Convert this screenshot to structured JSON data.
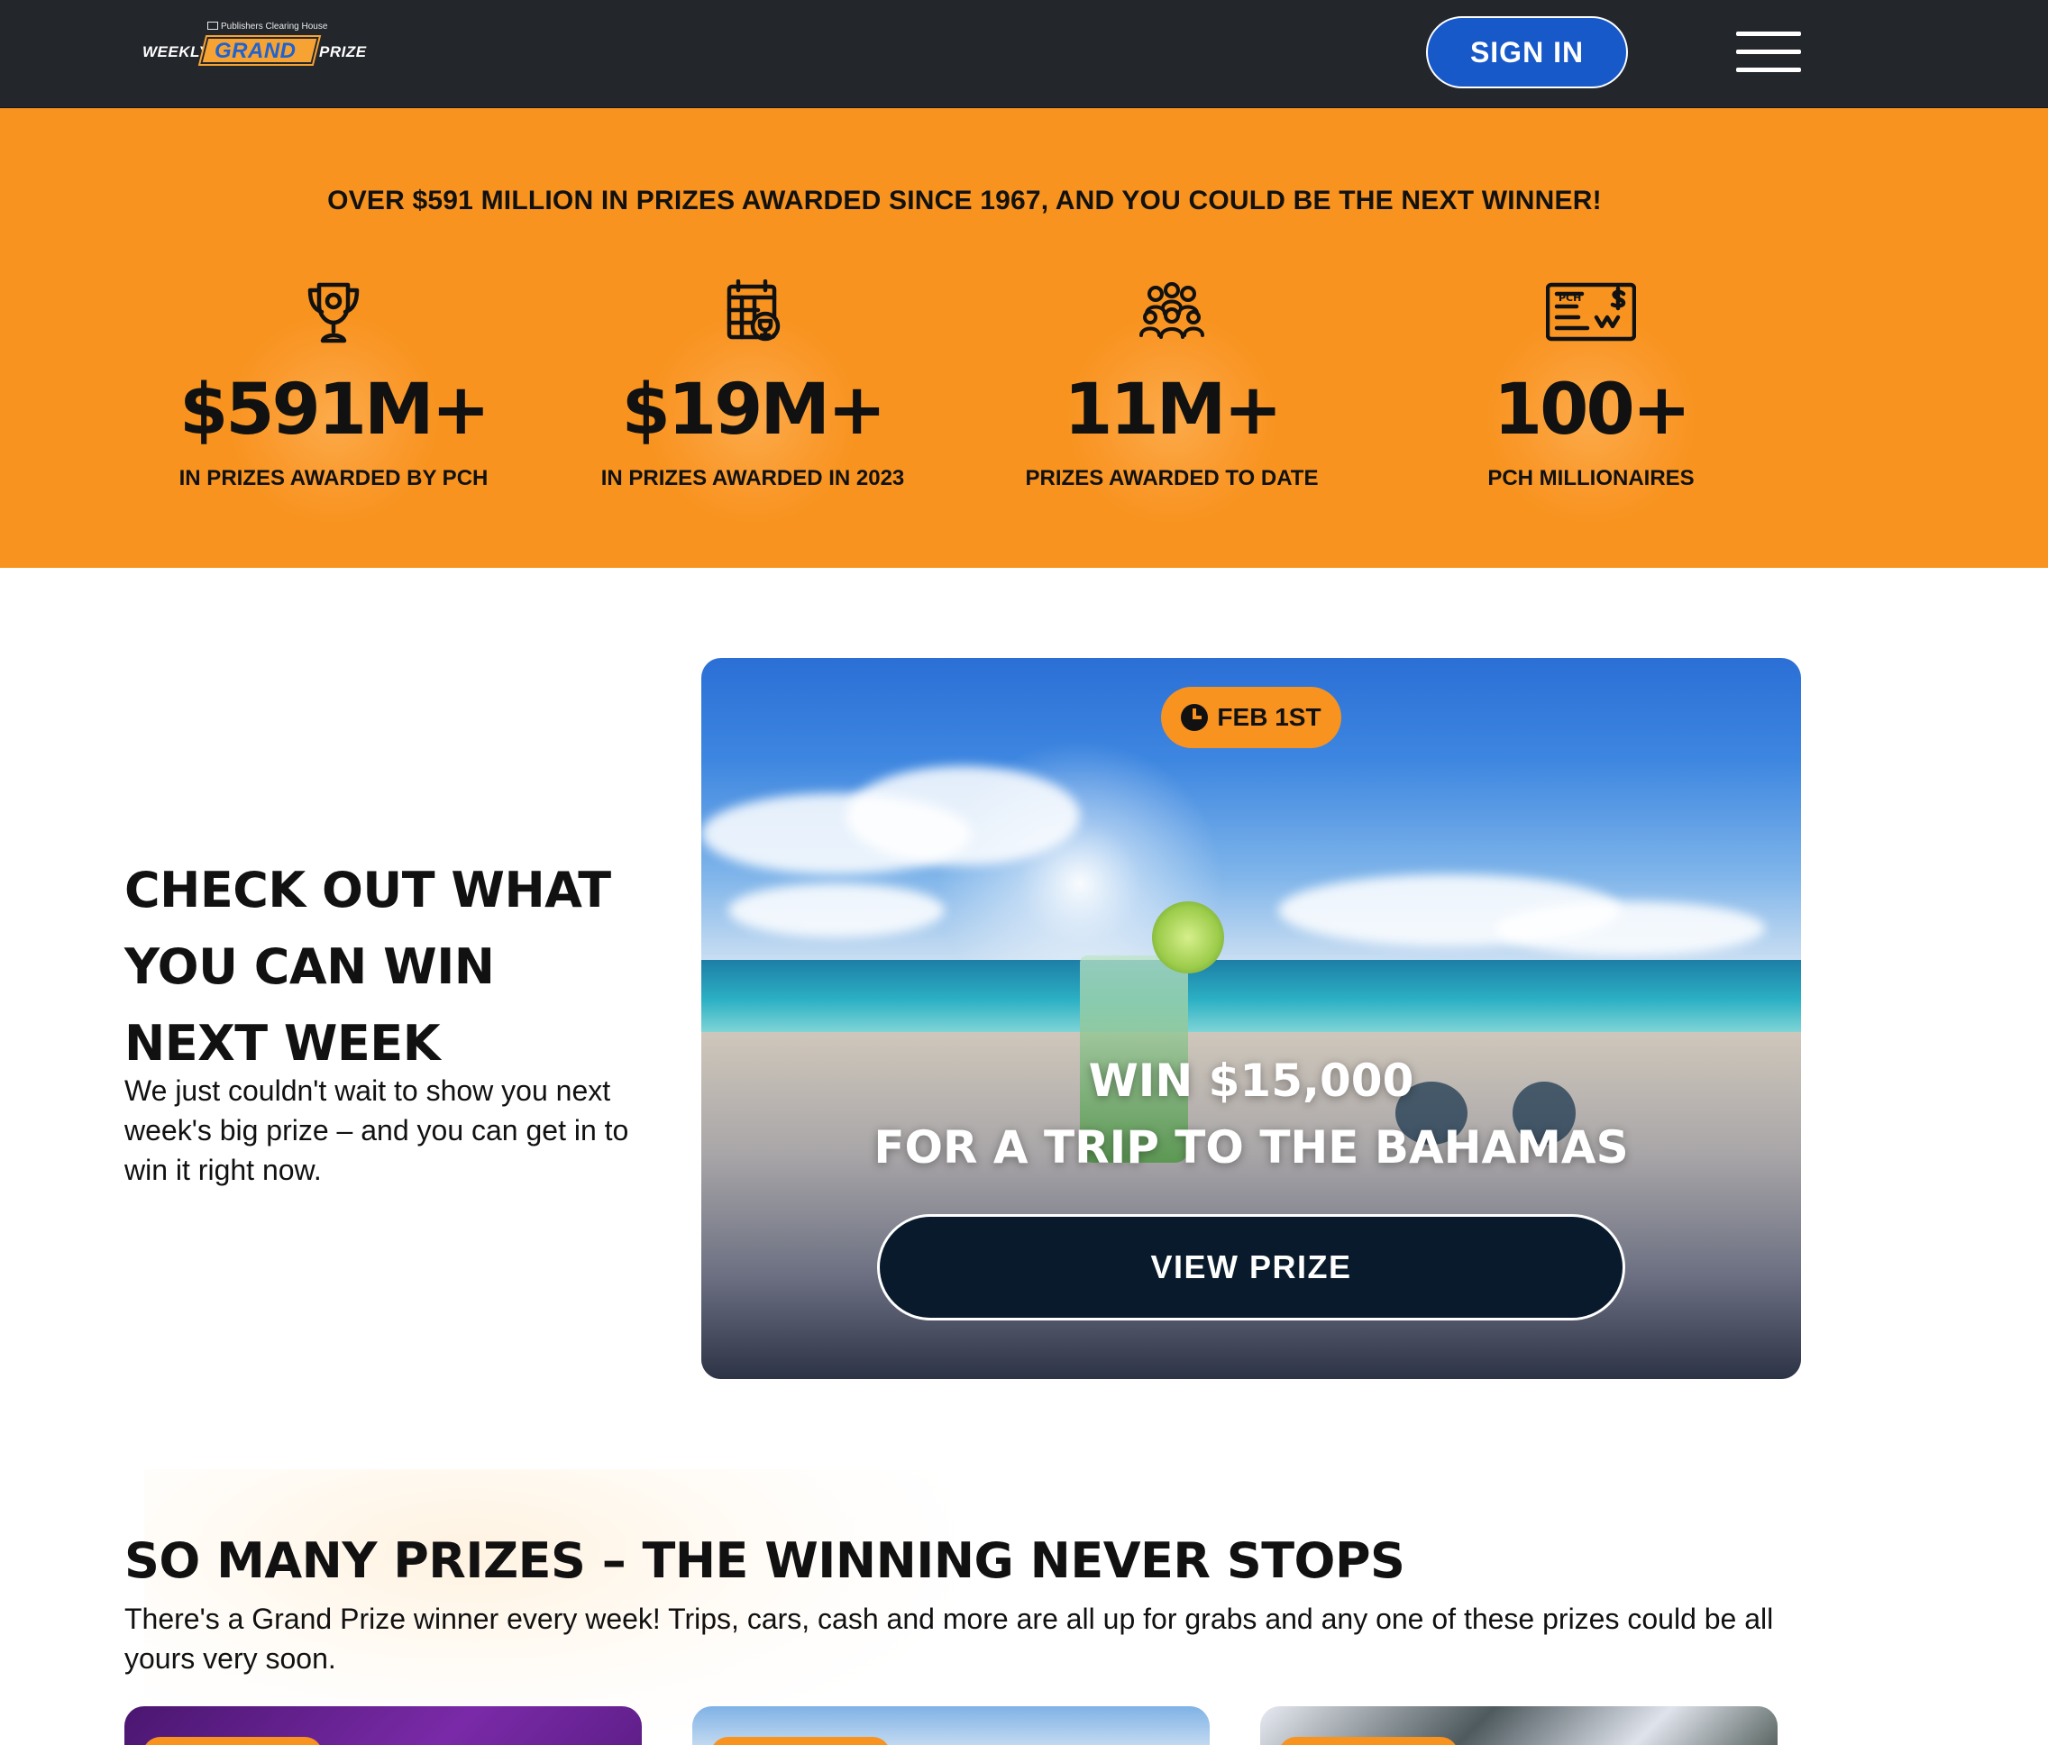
{
  "header": {
    "logo": {
      "publisher": "Publishers Clearing House",
      "word1": "WEEKLY",
      "word2": "GRAND",
      "word3": "PRIZE"
    },
    "sign_in_label": "SIGN IN",
    "menu_icon": "hamburger-menu-icon"
  },
  "stats": {
    "headline": "OVER $591 MILLION IN PRIZES AWARDED SINCE 1967, AND YOU COULD BE THE NEXT WINNER!",
    "items": [
      {
        "icon": "trophy-icon",
        "value": "$591M+",
        "label": "IN PRIZES AWARDED BY PCH"
      },
      {
        "icon": "calendar-trophy-icon",
        "value": "$19M+",
        "label": "IN PRIZES AWARDED IN 2023"
      },
      {
        "icon": "crowd-icon",
        "value": "11M+",
        "label": "PRIZES AWARDED TO DATE"
      },
      {
        "icon": "check-icon",
        "value": "100+",
        "label": "PCH MILLIONAIRES"
      }
    ]
  },
  "next_week": {
    "title_lines": [
      "CHECK OUT WHAT",
      "YOU CAN WIN",
      "NEXT WEEK"
    ],
    "description": "We just couldn't wait to show you next week's big prize – and you can get in to win it right now.",
    "card": {
      "date": "FEB 1ST",
      "line1": "WIN $15,000",
      "line2": "FOR A TRIP TO THE BAHAMAS",
      "button": "VIEW PRIZE"
    }
  },
  "so_many_prizes": {
    "title": "SO MANY PRIZES – THE WINNING NEVER STOPS",
    "description": "There's a Grand Prize winner every week! Trips, cars, cash and more are all up for grabs and any one of these prizes could be all yours very soon."
  },
  "colors": {
    "header_bg": "#23262b",
    "accent_orange": "#f8931f",
    "sign_in_blue": "#1859c9",
    "button_navy": "#081a2b"
  }
}
